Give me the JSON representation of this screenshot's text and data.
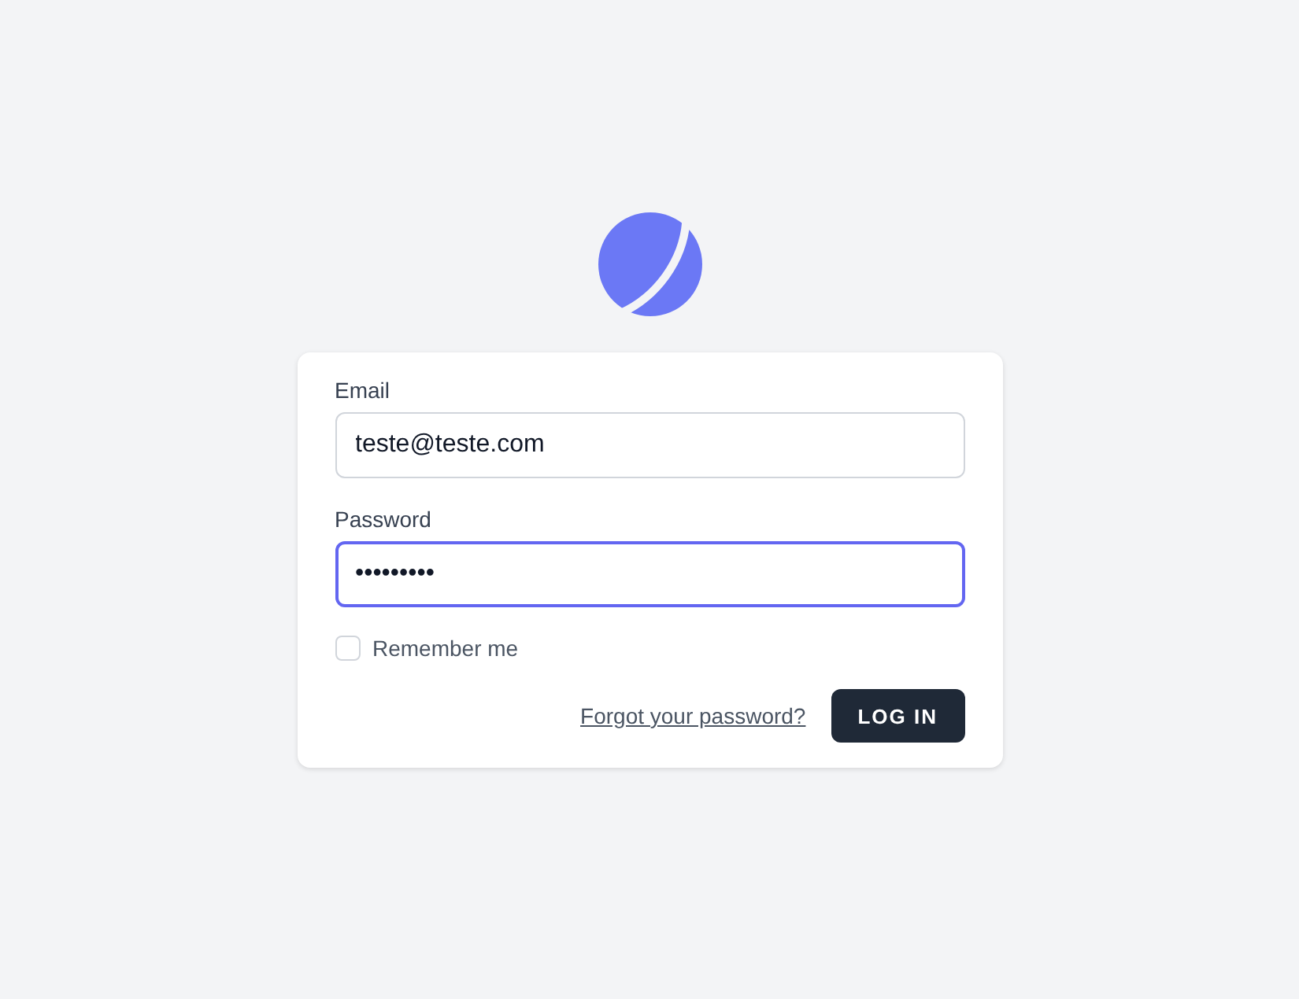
{
  "fields": [
    {
      "label": "Email",
      "value": "teste@teste.com",
      "focused": false
    },
    {
      "label": "Password",
      "value": "•••••••••",
      "focused": true
    }
  ],
  "remember": {
    "label": "Remember me",
    "checked": false
  },
  "forgot_link": "Forgot your password?",
  "login_button": "LOG IN"
}
